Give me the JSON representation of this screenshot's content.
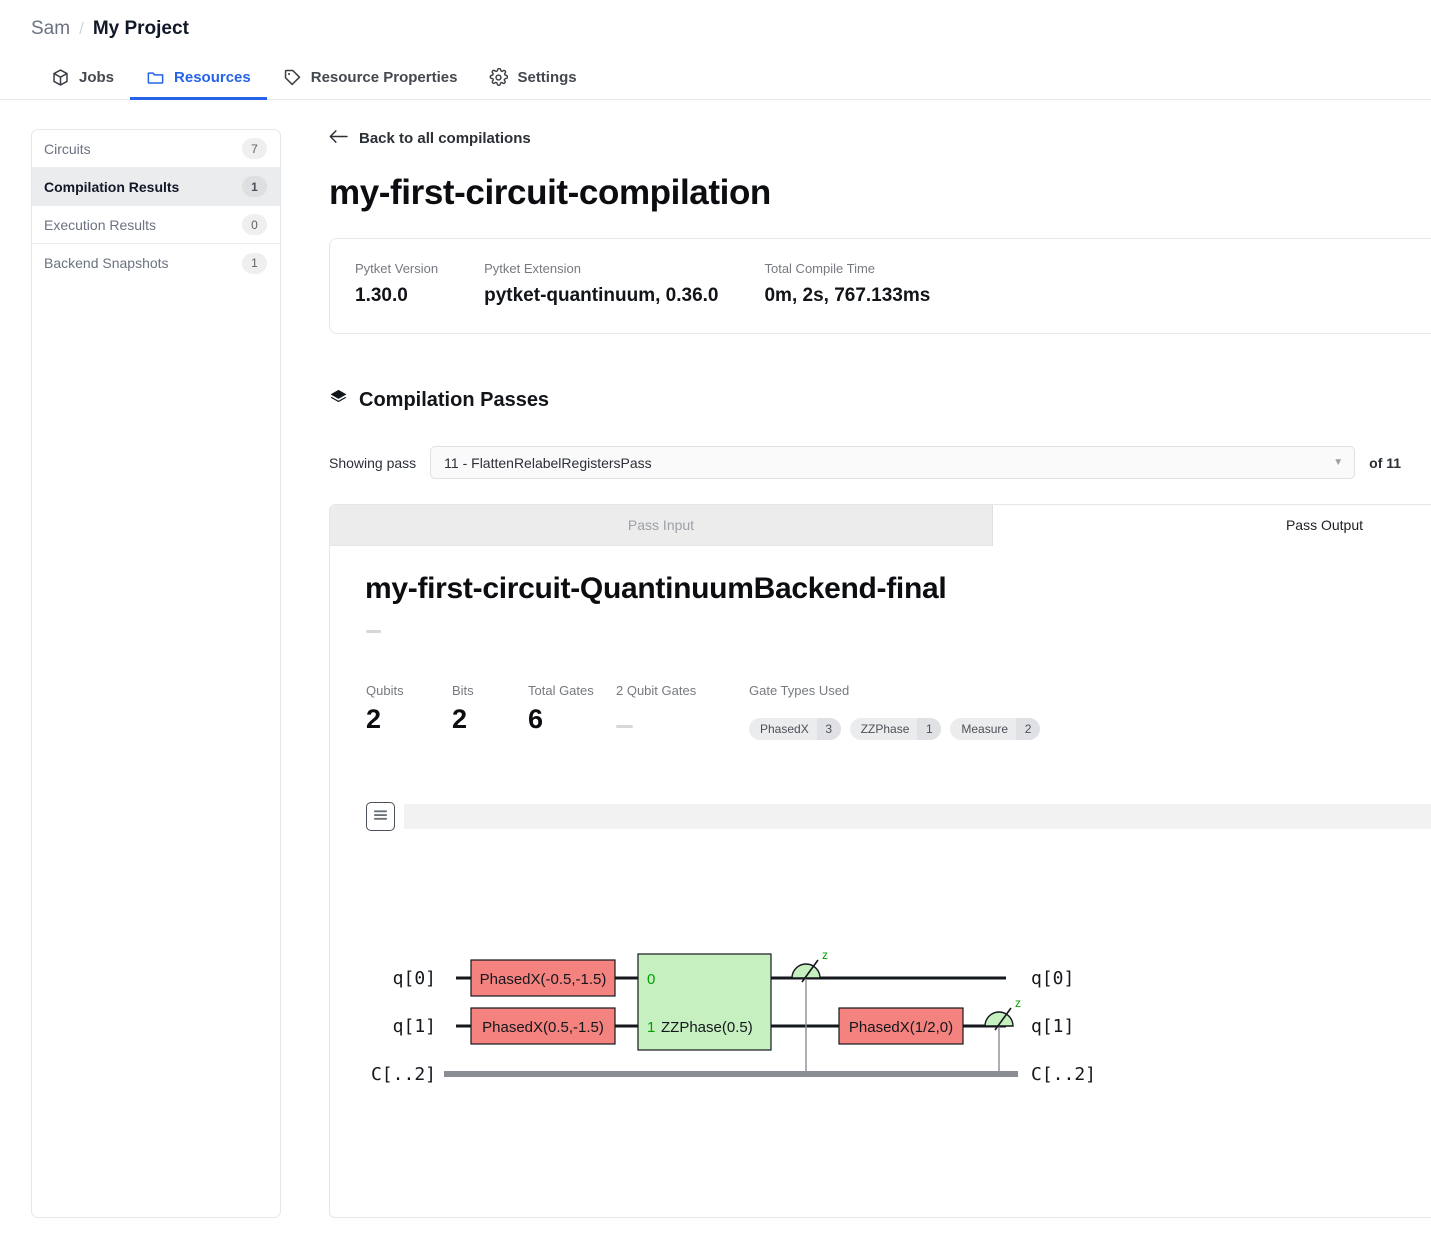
{
  "breadcrumb": {
    "owner": "Sam",
    "separator": "/",
    "project": "My Project"
  },
  "topnav": {
    "items": [
      {
        "label": "Jobs",
        "icon": "cube-icon",
        "active": false
      },
      {
        "label": "Resources",
        "icon": "folder-icon",
        "active": true
      },
      {
        "label": "Resource Properties",
        "icon": "tag-icon",
        "active": false
      },
      {
        "label": "Settings",
        "icon": "gear-icon",
        "active": false
      }
    ]
  },
  "sidebar": {
    "items": [
      {
        "label": "Circuits",
        "count": "7",
        "active": false
      },
      {
        "label": "Compilation Results",
        "count": "1",
        "active": true
      },
      {
        "label": "Execution Results",
        "count": "0",
        "active": false
      },
      {
        "label": "Backend Snapshots",
        "count": "1",
        "active": false
      }
    ]
  },
  "main": {
    "back_link": "Back to all compilations",
    "title": "my-first-circuit-compilation",
    "info": [
      {
        "label": "Pytket Version",
        "value": "1.30.0"
      },
      {
        "label": "Pytket Extension",
        "value": "pytket-quantinuum, 0.36.0"
      },
      {
        "label": "Total Compile Time",
        "value": "0m, 2s, 767.133ms"
      }
    ],
    "passes": {
      "section_title": "Compilation Passes",
      "showing_label": "Showing pass",
      "selected_pass": "11 - FlattenRelabelRegistersPass",
      "of_total": "of 11",
      "tabs": [
        {
          "label": "Pass Input",
          "active": false
        },
        {
          "label": "Pass Output",
          "active": true
        }
      ]
    },
    "circuit": {
      "title": "my-first-circuit-QuantinuumBackend-final",
      "stats": [
        {
          "label": "Qubits",
          "value": "2"
        },
        {
          "label": "Bits",
          "value": "2"
        },
        {
          "label": "Total Gates",
          "value": "6"
        },
        {
          "label": "2 Qubit Gates",
          "value": ""
        }
      ],
      "gate_types_label": "Gate Types Used",
      "gate_types": [
        {
          "name": "PhasedX",
          "count": "3"
        },
        {
          "name": "ZZPhase",
          "count": "1"
        },
        {
          "name": "Measure",
          "count": "2"
        }
      ],
      "toolbar": {
        "menu": "hamburger-icon",
        "zoom_in": "zoom-in-icon",
        "zoom_reset": "zoom-reset-icon",
        "download": "download-icon"
      },
      "diagram": {
        "registers_left": [
          "q[0]",
          "q[1]",
          "C[..2]"
        ],
        "registers_right": [
          "q[0]",
          "q[1]",
          "C[..2]"
        ],
        "gates": [
          {
            "label": "PhasedX(-0.5,-1.5)",
            "wire": "q[0]",
            "color": "#f4827f"
          },
          {
            "label": "PhasedX(0.5,-1.5)",
            "wire": "q[1]",
            "color": "#f4827f"
          },
          {
            "label": "ZZPhase(0.5)",
            "wire": "q[0]+q[1]",
            "color": "#c7f0c0",
            "port_top": "0",
            "port_bottom": "1"
          },
          {
            "label": "PhasedX(1/2,0)",
            "wire": "q[1]",
            "color": "#f4827f"
          },
          {
            "label": "Measure",
            "wire": "q[0]",
            "basis": "z"
          },
          {
            "label": "Measure",
            "wire": "q[1]",
            "basis": "z"
          }
        ]
      }
    }
  },
  "colors": {
    "accent": "#2563eb",
    "gate_red": "#f4827f",
    "gate_green": "#c7f0c0",
    "green_text": "#00a000"
  }
}
